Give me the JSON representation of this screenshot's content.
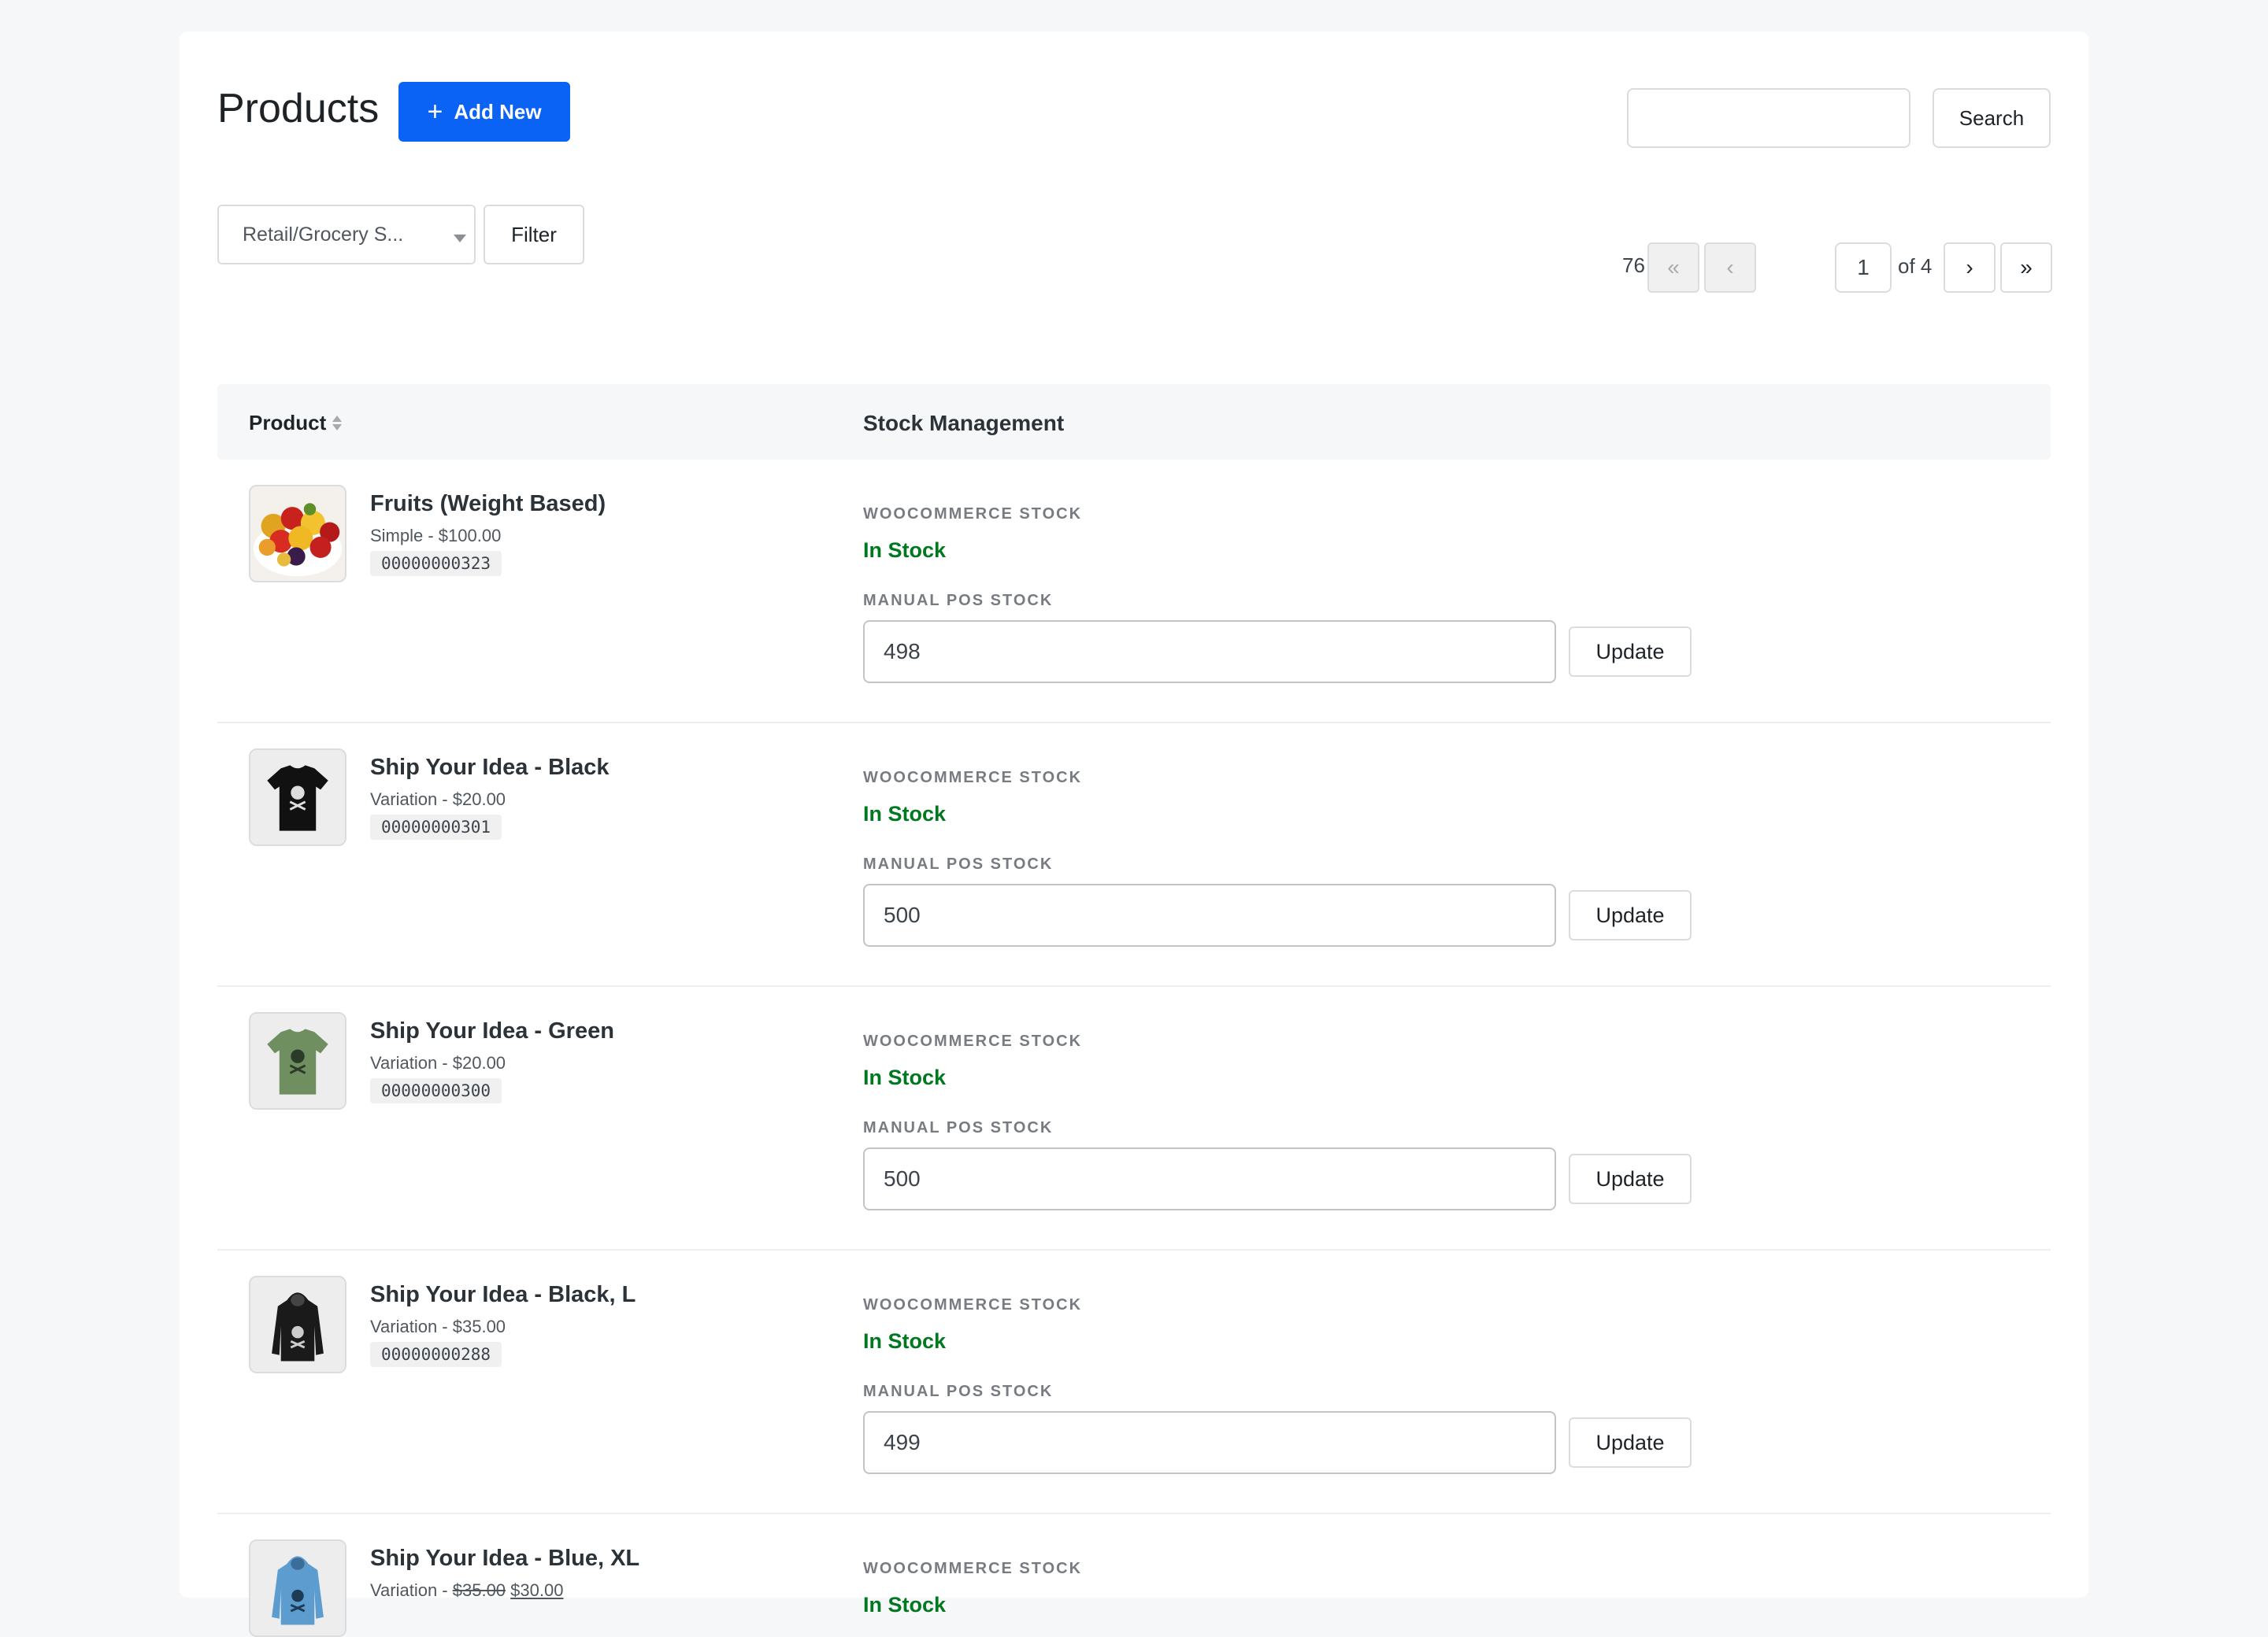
{
  "header": {
    "title": "Products",
    "add_new_label": "Add New",
    "search_value": "",
    "search_label": "Search"
  },
  "filters": {
    "store_select_value": "Retail/Grocery S...",
    "filter_label": "Filter"
  },
  "pagination": {
    "items_count": "76 items",
    "first_label": "«",
    "prev_label": "‹",
    "current_page": "1",
    "of_label": "of 4",
    "next_label": "›",
    "last_label": "»"
  },
  "table": {
    "col_product": "Product",
    "col_stock": "Stock Management",
    "woo_label": "WOOCOMMERCE STOCK",
    "manual_label": "MANUAL POS STOCK",
    "update_label": "Update",
    "rows": [
      {
        "name": "Fruits (Weight Based)",
        "meta": "Simple - $100.00",
        "sku": "00000000323",
        "status": "In Stock",
        "qty": "498",
        "thumb": "fruit-bowl"
      },
      {
        "name": "Ship Your Idea - Black",
        "meta": "Variation - $20.00",
        "sku": "00000000301",
        "status": "In Stock",
        "qty": "500",
        "thumb": "tshirt-black"
      },
      {
        "name": "Ship Your Idea - Green",
        "meta": "Variation - $20.00",
        "sku": "00000000300",
        "status": "In Stock",
        "qty": "500",
        "thumb": "tshirt-green"
      },
      {
        "name": "Ship Your Idea - Black, L",
        "meta": "Variation - $35.00",
        "sku": "00000000288",
        "status": "In Stock",
        "qty": "499",
        "thumb": "hoodie-black"
      },
      {
        "name": "Ship Your Idea - Blue, XL",
        "meta_prefix": "Variation - ",
        "meta_old_price": "$35.00",
        "meta_new_price": "$30.00",
        "sku": "",
        "status": "In Stock",
        "qty": "",
        "thumb": "hoodie-blue"
      }
    ]
  },
  "colors": {
    "primary": "#0a63f5",
    "in_stock": "#00781f",
    "page_bg": "#f6f7f9"
  }
}
